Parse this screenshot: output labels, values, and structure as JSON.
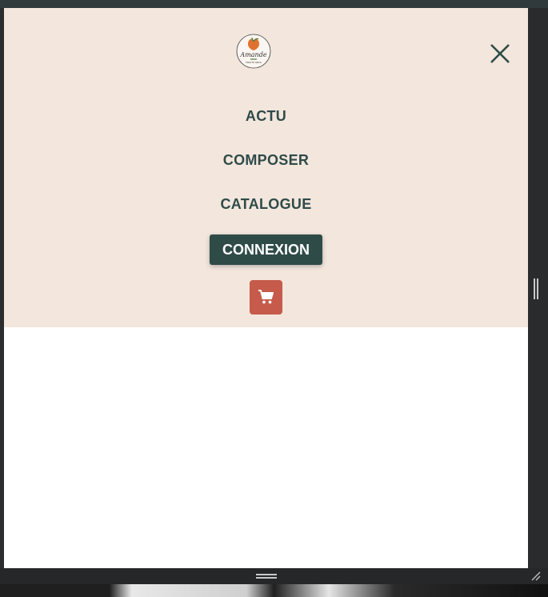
{
  "brand": {
    "logo_text": "Amande",
    "logo_subtext": "FRUITS SECS"
  },
  "nav": {
    "items": [
      {
        "label": "ACTU"
      },
      {
        "label": "COMPOSER"
      },
      {
        "label": "CATALOGUE"
      }
    ],
    "login_label": "CONNEXION"
  },
  "icons": {
    "close": "close-icon",
    "cart": "cart-icon"
  },
  "colors": {
    "menu_background": "#f2e6dd",
    "nav_text": "#2f4b48",
    "login_button": "#2f4b48",
    "cart_button": "#c65a4b"
  }
}
